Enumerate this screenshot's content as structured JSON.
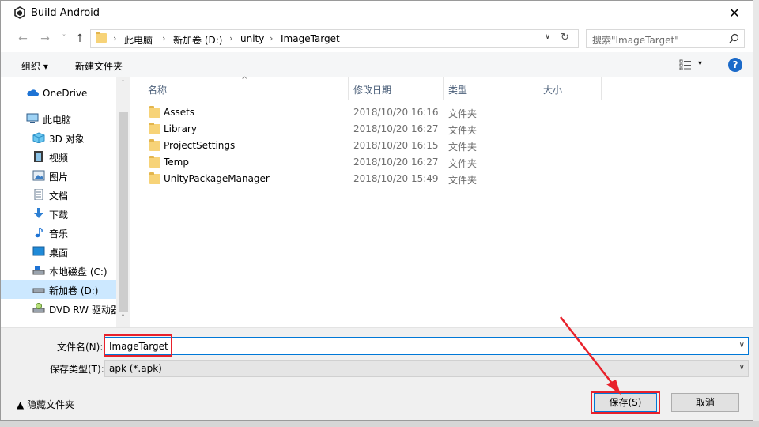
{
  "window": {
    "title": "Build Android",
    "close_glyph": "✕"
  },
  "nav": {
    "back": "←",
    "forward": "→",
    "up": "↑"
  },
  "address": {
    "separator": "›",
    "crumbs": [
      "此电脑",
      "新加卷 (D:)",
      "unity",
      "ImageTarget"
    ],
    "dropdown": "∨",
    "refresh": "↻"
  },
  "search": {
    "placeholder": "搜索\"ImageTarget\""
  },
  "toolbar": {
    "organize": "组织 ▾",
    "new_folder": "新建文件夹",
    "view_drop": "▾",
    "help": "?"
  },
  "sidebar": {
    "items": [
      {
        "label": "OneDrive",
        "icon": "cloud-icon"
      },
      {
        "label": "此电脑",
        "icon": "computer-icon"
      },
      {
        "label": "3D 对象",
        "icon": "cube-icon"
      },
      {
        "label": "视频",
        "icon": "film-icon"
      },
      {
        "label": "图片",
        "icon": "picture-icon"
      },
      {
        "label": "文档",
        "icon": "document-icon"
      },
      {
        "label": "下载",
        "icon": "download-icon"
      },
      {
        "label": "音乐",
        "icon": "music-icon"
      },
      {
        "label": "桌面",
        "icon": "desktop-icon"
      },
      {
        "label": "本地磁盘 (C:)",
        "icon": "drive-icon"
      },
      {
        "label": "新加卷 (D:)",
        "icon": "drive-icon"
      },
      {
        "label": "DVD RW 驱动器",
        "icon": "dvd-icon"
      }
    ],
    "scroll_up": "˄",
    "scroll_down": "˅"
  },
  "columns": {
    "name": "名称",
    "modified": "修改日期",
    "type": "类型",
    "size": "大小",
    "sort_glyph": "^"
  },
  "files": [
    {
      "name": "Assets",
      "modified": "2018/10/20 16:16",
      "type": "文件夹"
    },
    {
      "name": "Library",
      "modified": "2018/10/20 16:27",
      "type": "文件夹"
    },
    {
      "name": "ProjectSettings",
      "modified": "2018/10/20 16:15",
      "type": "文件夹"
    },
    {
      "name": "Temp",
      "modified": "2018/10/20 16:27",
      "type": "文件夹"
    },
    {
      "name": "UnityPackageManager",
      "modified": "2018/10/20 15:49",
      "type": "文件夹"
    }
  ],
  "form": {
    "filename_label": "文件名(N):",
    "filename_value": "ImageTarget",
    "filetype_label": "保存类型(T):",
    "filetype_value": "apk (*.apk)",
    "dropdown_glyph": "∨"
  },
  "footer": {
    "hide_folders": "▲  隐藏文件夹",
    "save": "保存(S)",
    "cancel": "取消"
  },
  "colors": {
    "highlight": "#e8212b",
    "selection": "#cce8ff",
    "accent": "#0078d7"
  }
}
